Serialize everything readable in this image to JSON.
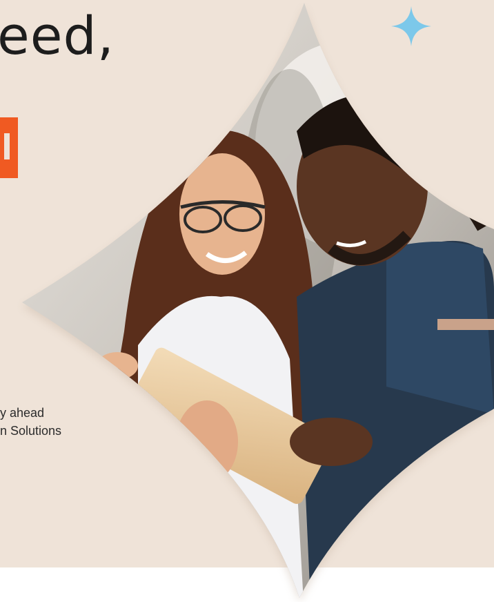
{
  "hero": {
    "headline": "eed,",
    "body_lines": [
      "y ahead",
      "n Solutions"
    ]
  },
  "icons": {
    "sparkle": "sparkle-icon",
    "photo": "people-looking-at-tablet-photo"
  },
  "colors": {
    "background": "#efe3d8",
    "accent_orange": "#f05a22",
    "sparkle_blue": "#7cc8ea",
    "text": "#1d1d1d"
  }
}
